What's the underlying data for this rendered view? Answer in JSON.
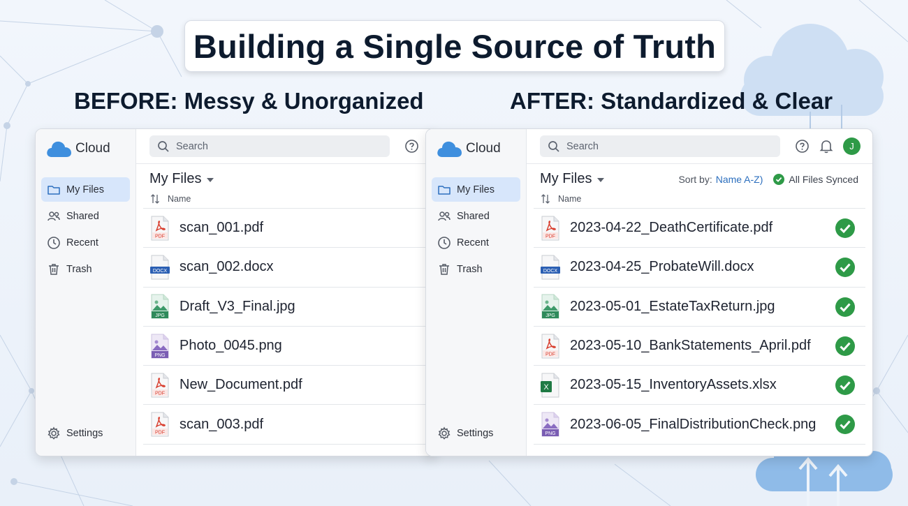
{
  "title": "Building a Single Source of Truth",
  "before_heading": "BEFORE: Messy & Unorganized",
  "after_heading": "AFTER: Standardized & Clear",
  "colors": {
    "accent_blue": "#2c6fbe",
    "success_green": "#2e9a47",
    "nav_active_bg": "#d7e6fb",
    "title_text": "#0d1b2e"
  },
  "before": {
    "brand": "Cloud",
    "nav": [
      {
        "label": "My Files",
        "icon": "folder-icon",
        "active": true
      },
      {
        "label": "Shared",
        "icon": "people-icon",
        "active": false
      },
      {
        "label": "Recent",
        "icon": "clock-icon",
        "active": false
      },
      {
        "label": "Trash",
        "icon": "trash-icon",
        "active": false
      }
    ],
    "settings_label": "Settings",
    "search_placeholder": "Search",
    "files_title": "My Files",
    "column_name": "Name",
    "files": [
      {
        "name": "scan_001.pdf",
        "type": "PDF"
      },
      {
        "name": "scan_002.docx",
        "type": "DOCX"
      },
      {
        "name": "Draft_V3_Final.jpg",
        "type": "JPG"
      },
      {
        "name": "Photo_0045.png",
        "type": "PNG"
      },
      {
        "name": "New_Document.pdf",
        "type": "PDF"
      },
      {
        "name": "scan_003.pdf",
        "type": "PDF"
      }
    ]
  },
  "after": {
    "brand": "Cloud",
    "nav": [
      {
        "label": "My Files",
        "icon": "folder-icon",
        "active": true
      },
      {
        "label": "Shared",
        "icon": "people-icon",
        "active": false
      },
      {
        "label": "Recent",
        "icon": "clock-icon",
        "active": false
      },
      {
        "label": "Trash",
        "icon": "trash-icon",
        "active": false
      }
    ],
    "settings_label": "Settings",
    "search_placeholder": "Search",
    "avatar_initial": "J",
    "files_title": "My Files",
    "sort_label": "Sort by:",
    "sort_value": "Name A-Z)",
    "sync_status": "All Files Synced",
    "column_name": "Name",
    "files": [
      {
        "name": "2023-04-22_DeathCertificate.pdf",
        "type": "PDF"
      },
      {
        "name": "2023-04-25_ProbateWill.docx",
        "type": "DOCX"
      },
      {
        "name": "2023-05-01_EstateTaxReturn.jpg",
        "type": "JPG"
      },
      {
        "name": "2023-05-10_BankStatements_April.pdf",
        "type": "PDF"
      },
      {
        "name": "2023-05-15_InventoryAssets.xlsx",
        "type": "XLSX"
      },
      {
        "name": "2023-06-05_FinalDistributionCheck.png",
        "type": "PNG"
      }
    ]
  }
}
